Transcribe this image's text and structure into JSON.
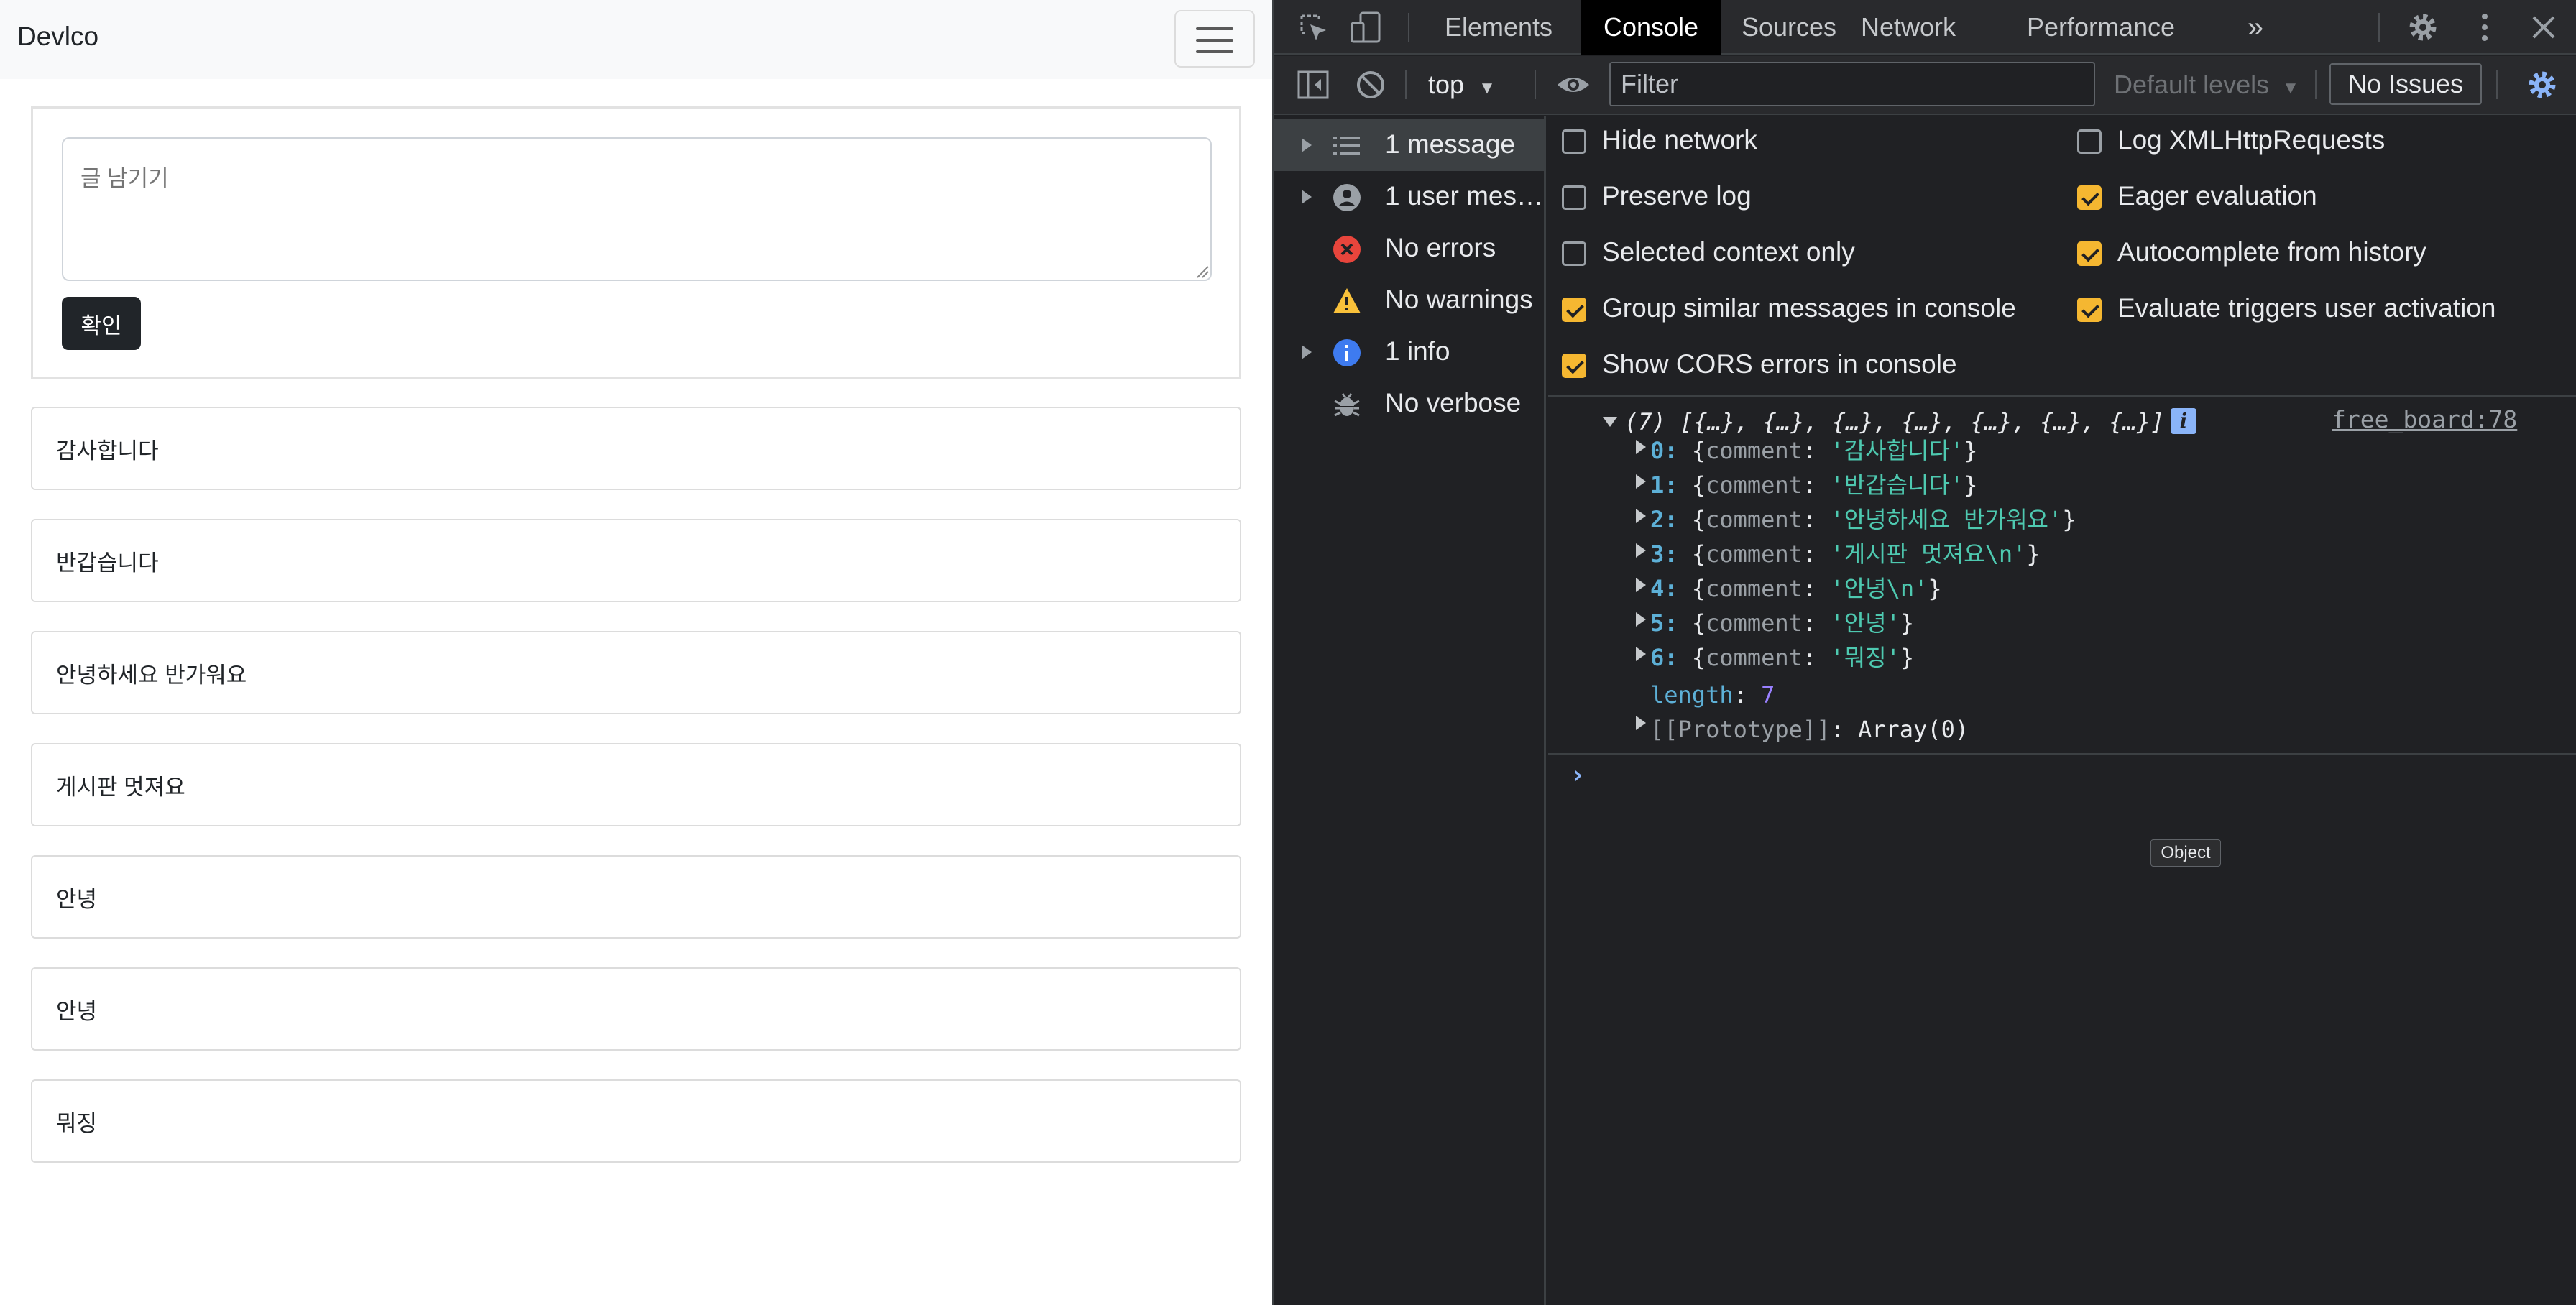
{
  "app": {
    "brand": "Devlco",
    "textarea_placeholder": "글 남기기",
    "submit_label": "확인",
    "comments": [
      "감사합니다",
      "반갑습니다",
      "안녕하세요 반가워요",
      "게시판 멋져요",
      "안녕",
      "안녕",
      "뭐징"
    ]
  },
  "devtools": {
    "tabs": [
      "Elements",
      "Console",
      "Sources",
      "Network",
      "Performance"
    ],
    "active_tab": "Console",
    "more_tabs": "»",
    "context": "top",
    "filter_placeholder": "Filter",
    "levels": "Default levels",
    "issues": "No Issues",
    "sidebar": [
      {
        "label": "1 message",
        "icon": "list-icon",
        "expandable": true,
        "selected": true
      },
      {
        "label": "1 user mes…",
        "icon": "user-icon",
        "expandable": true,
        "selected": false
      },
      {
        "label": "No errors",
        "icon": "error-icon",
        "expandable": false,
        "selected": false
      },
      {
        "label": "No warnings",
        "icon": "warning-icon",
        "expandable": false,
        "selected": false
      },
      {
        "label": "1 info",
        "icon": "info-icon",
        "expandable": true,
        "selected": false
      },
      {
        "label": "No verbose",
        "icon": "bug-icon",
        "expandable": false,
        "selected": false
      }
    ],
    "settings_left": [
      {
        "label": "Hide network",
        "checked": false
      },
      {
        "label": "Preserve log",
        "checked": false
      },
      {
        "label": "Selected context only",
        "checked": false
      },
      {
        "label": "Group similar messages in console",
        "checked": true
      },
      {
        "label": "Show CORS errors in console",
        "checked": true
      }
    ],
    "settings_right": [
      {
        "label": "Log XMLHttpRequests",
        "checked": false
      },
      {
        "label": "Eager evaluation",
        "checked": true
      },
      {
        "label": "Autocomplete from history",
        "checked": true
      },
      {
        "label": "Evaluate triggers user activation",
        "checked": true
      }
    ],
    "console": {
      "summary": "(7) [{…}, {…}, {…}, {…}, {…}, {…}, {…}]",
      "source": "free_board:78",
      "prop_key": "comment",
      "entries": [
        {
          "index": "0",
          "value": "'감사합니다'"
        },
        {
          "index": "1",
          "value": "'반갑습니다'"
        },
        {
          "index": "2",
          "value": "'안녕하세요 반가워요'"
        },
        {
          "index": "3",
          "value": "'게시판 멋져요\\n'"
        },
        {
          "index": "4",
          "value": "'안녕\\n'"
        },
        {
          "index": "5",
          "value": "'안녕'"
        },
        {
          "index": "6",
          "value": "'뭐징'"
        }
      ],
      "length_key": "length",
      "length_value": "7",
      "prototype_key": "[[Prototype]]",
      "prototype_value": "Array(0)",
      "tooltip": "Object",
      "prompt": "›"
    },
    "colors": {
      "accent_checkbox": "#f5b731",
      "error": "#e8453c",
      "warning": "#f9c13a",
      "info": "#3e7bf0",
      "link": "#8ab4f8"
    }
  }
}
